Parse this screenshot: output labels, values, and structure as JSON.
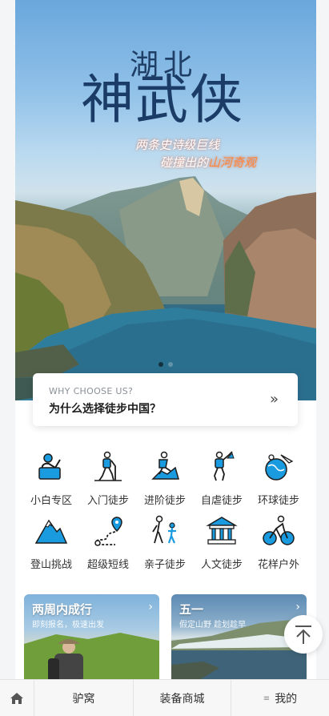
{
  "hero": {
    "title_small": "湖北",
    "title_big": "神武侠",
    "subtitle_line1": "两条史诗级巨线",
    "subtitle_line2_prefix": "碰撞出的",
    "subtitle_line2_highlight": "山河奇观",
    "carousel": {
      "count": 2,
      "active": 1
    }
  },
  "why_card": {
    "en": "WHY CHOOSE US?",
    "cn": "为什么选择徒步中国？",
    "arrow": "»"
  },
  "categories": [
    {
      "label": "小白专区",
      "icon": "beginner-hiker-icon"
    },
    {
      "label": "入门徒步",
      "icon": "hiker-icon"
    },
    {
      "label": "进阶徒步",
      "icon": "climber-icon"
    },
    {
      "label": "自虐徒步",
      "icon": "extreme-hiker-icon"
    },
    {
      "label": "环球徒步",
      "icon": "globe-plane-icon"
    },
    {
      "label": "登山挑战",
      "icon": "mountain-icon"
    },
    {
      "label": "超级短线",
      "icon": "route-pin-icon"
    },
    {
      "label": "亲子徒步",
      "icon": "family-icon"
    },
    {
      "label": "人文徒步",
      "icon": "temple-icon"
    },
    {
      "label": "花样户外",
      "icon": "cyclist-icon"
    }
  ],
  "promos": [
    {
      "title": "两周内成行",
      "subtitle": "即刻报名，极速出发",
      "chevron": "›"
    },
    {
      "title": "五一",
      "subtitle": "假定山野 趁划趁早",
      "chevron": "›"
    }
  ],
  "tabbar": {
    "home_icon": "home-icon",
    "tab1": "驴窝",
    "tab2": "装备商城",
    "tab3_icon": "≡",
    "tab3": "我的"
  },
  "colors": {
    "accent": "#1a9be0",
    "icon_stroke": "#1c1c1c"
  }
}
